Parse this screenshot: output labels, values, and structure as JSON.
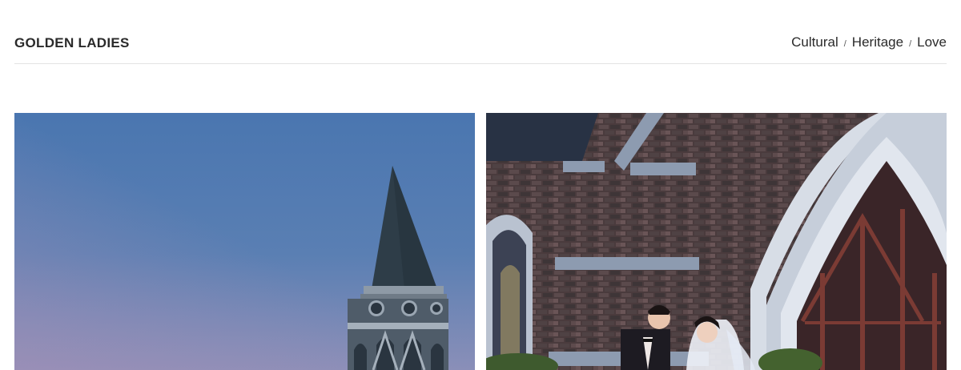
{
  "header": {
    "brand": "GOLDEN LADIES",
    "tags": [
      "Cultural",
      "Heritage",
      "Love"
    ],
    "separator": "/"
  },
  "gallery": {
    "images": [
      {
        "subject": "church-spire-at-dusk"
      },
      {
        "subject": "couple-at-brick-church"
      }
    ]
  },
  "colors": {
    "text": "#2a2a2a",
    "divider": "#e3e3e3",
    "sky": "#4f74a8"
  }
}
